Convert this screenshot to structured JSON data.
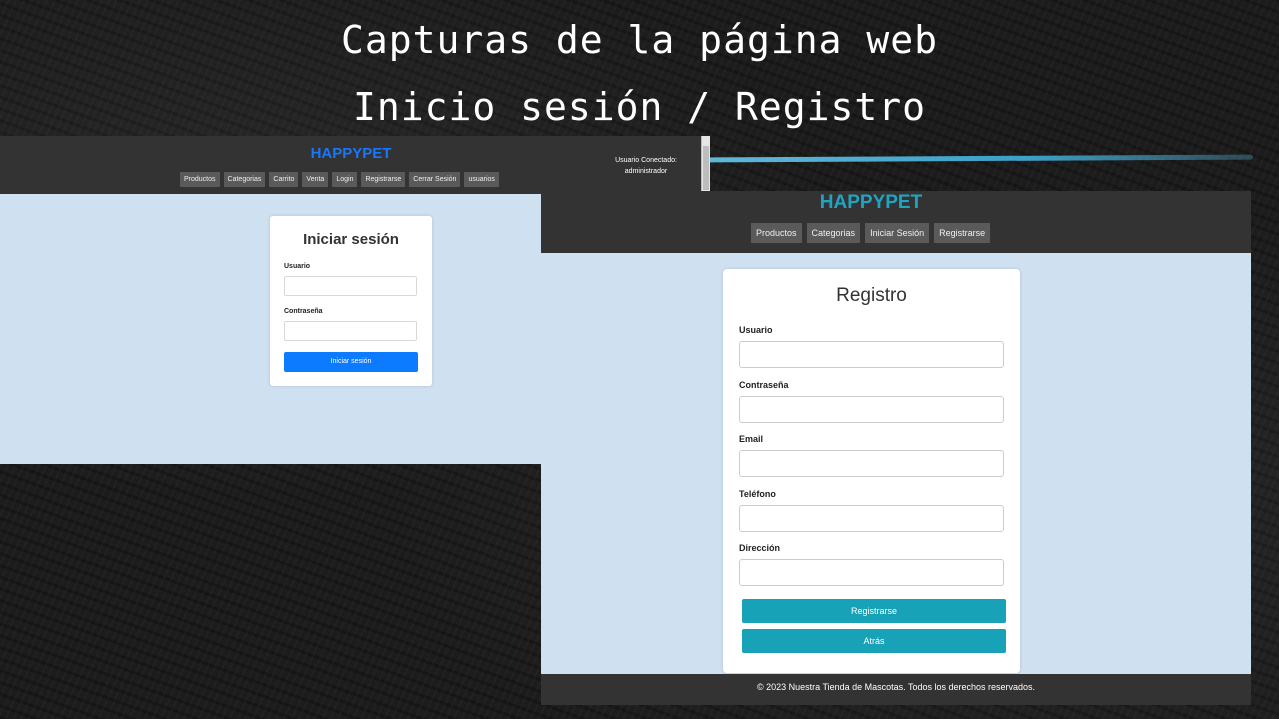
{
  "slide": {
    "title": "Capturas de la página web",
    "subtitle": "Inicio sesión / Registro"
  },
  "login_page": {
    "brand": "HAPPYPET",
    "nav_items": [
      "Productos",
      "Categorias",
      "Carrito",
      "Venta",
      "Login",
      "Registrarse",
      "Cerrar Sesión",
      "usuarios"
    ],
    "user_status_label": "Usuario Conectado:",
    "user_status_name": "administrador",
    "form": {
      "title": "Iniciar sesión",
      "username_label": "Usuario",
      "username_value": "",
      "password_label": "Contraseña",
      "password_value": "",
      "submit_label": "Iniciar sesión"
    },
    "colors": {
      "brand": "#1677ff",
      "button": "#0d7bff",
      "background": "#cfe0f0",
      "navbar": "#333333"
    }
  },
  "register_page": {
    "brand": "HAPPYPET",
    "nav_items": [
      "Productos",
      "Categorias",
      "Iniciar Sesión",
      "Registrarse"
    ],
    "form": {
      "title": "Registro",
      "fields": [
        {
          "label": "Usuario",
          "value": ""
        },
        {
          "label": "Contraseña",
          "value": ""
        },
        {
          "label": "Email",
          "value": ""
        },
        {
          "label": "Teléfono",
          "value": ""
        },
        {
          "label": "Dirección",
          "value": ""
        }
      ],
      "submit_label": "Registrarse",
      "back_label": "Atrás"
    },
    "footer": "© 2023 Nuestra Tienda de Mascotas. Todos los derechos reservados.",
    "colors": {
      "brand": "#21a4c2",
      "button": "#17a2b8",
      "background": "#cfe0f0",
      "navbar": "#333333"
    }
  }
}
